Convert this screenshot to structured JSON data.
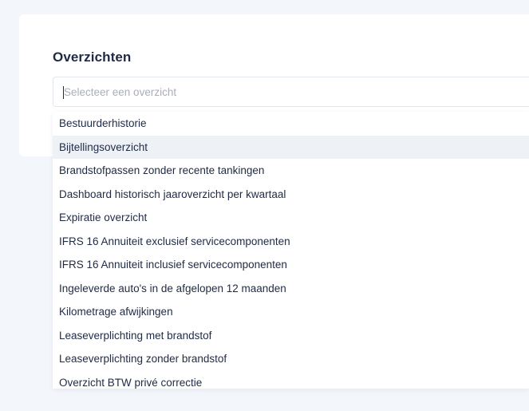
{
  "section": {
    "title": "Overzichten"
  },
  "search": {
    "placeholder": "Selecteer een overzicht",
    "value": ""
  },
  "dropdown": {
    "highlighted_index": 1,
    "options": [
      "Bestuurderhistorie",
      "Bijtellingsoverzicht",
      "Brandstofpassen zonder recente tankingen",
      "Dashboard historisch jaaroverzicht per kwartaal",
      "Expiratie overzicht",
      "IFRS 16 Annuiteit exclusief servicecomponenten",
      "IFRS 16 Annuiteit inclusief servicecomponenten",
      "Ingeleverde auto's in de afgelopen 12 maanden",
      "Kilometrage afwijkingen",
      "Leaseverplichting met brandstof",
      "Leaseverplichting zonder brandstof",
      "Overzicht BTW privé correctie"
    ]
  },
  "colors": {
    "background": "#f3f6fb",
    "card": "#ffffff",
    "text": "#1f2a44",
    "placeholder": "#a9afbb",
    "hover": "#eef1f6"
  }
}
